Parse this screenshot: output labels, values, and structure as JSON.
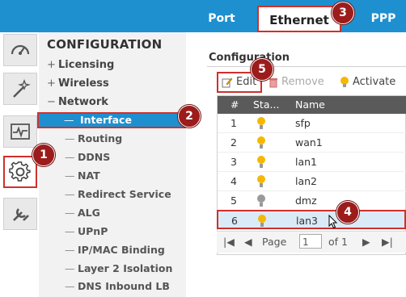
{
  "tabs": {
    "port": "Port",
    "ethernet": "Ethernet",
    "ppp": "PPP"
  },
  "nav": {
    "title": "CONFIGURATION",
    "top_items": [
      {
        "prefix": "+",
        "label": "Licensing"
      },
      {
        "prefix": "+",
        "label": "Wireless"
      },
      {
        "prefix": "−",
        "label": "Network"
      }
    ],
    "sub_items": [
      {
        "label": "Interface",
        "selected": true
      },
      {
        "label": "Routing"
      },
      {
        "label": "DDNS"
      },
      {
        "label": "NAT"
      },
      {
        "label": "Redirect Service"
      },
      {
        "label": "ALG"
      },
      {
        "label": "UPnP"
      },
      {
        "label": "IP/MAC Binding"
      },
      {
        "label": "Layer 2 Isolation"
      },
      {
        "label": "DNS Inbound LB"
      }
    ]
  },
  "rail_icons": [
    "dashboard-icon",
    "wizard-icon",
    "monitor-icon",
    "configuration-icon",
    "maintenance-icon"
  ],
  "content": {
    "title": "Configuration",
    "toolbar": {
      "edit": "Edit",
      "remove": "Remove",
      "activate": "Activate"
    },
    "headers": {
      "num": "#",
      "status": "Sta...",
      "name": "Name"
    },
    "rows": [
      {
        "num": "1",
        "status": "on",
        "name": "sfp"
      },
      {
        "num": "2",
        "status": "on",
        "name": "wan1"
      },
      {
        "num": "3",
        "status": "on",
        "name": "lan1"
      },
      {
        "num": "4",
        "status": "on",
        "name": "lan2"
      },
      {
        "num": "5",
        "status": "off",
        "name": "dmz"
      },
      {
        "num": "6",
        "status": "on",
        "name": "lan3"
      }
    ],
    "pager": {
      "page_label": "Page",
      "page_value": "1",
      "of_label": "of 1"
    }
  },
  "callouts": [
    "1",
    "2",
    "3",
    "4",
    "5"
  ],
  "colors": {
    "accent": "#1e90d0",
    "highlight": "#d0302c",
    "callout": "#9c1c1c",
    "bulb_on": "#f5b800",
    "bulb_off": "#9a9a9a"
  }
}
